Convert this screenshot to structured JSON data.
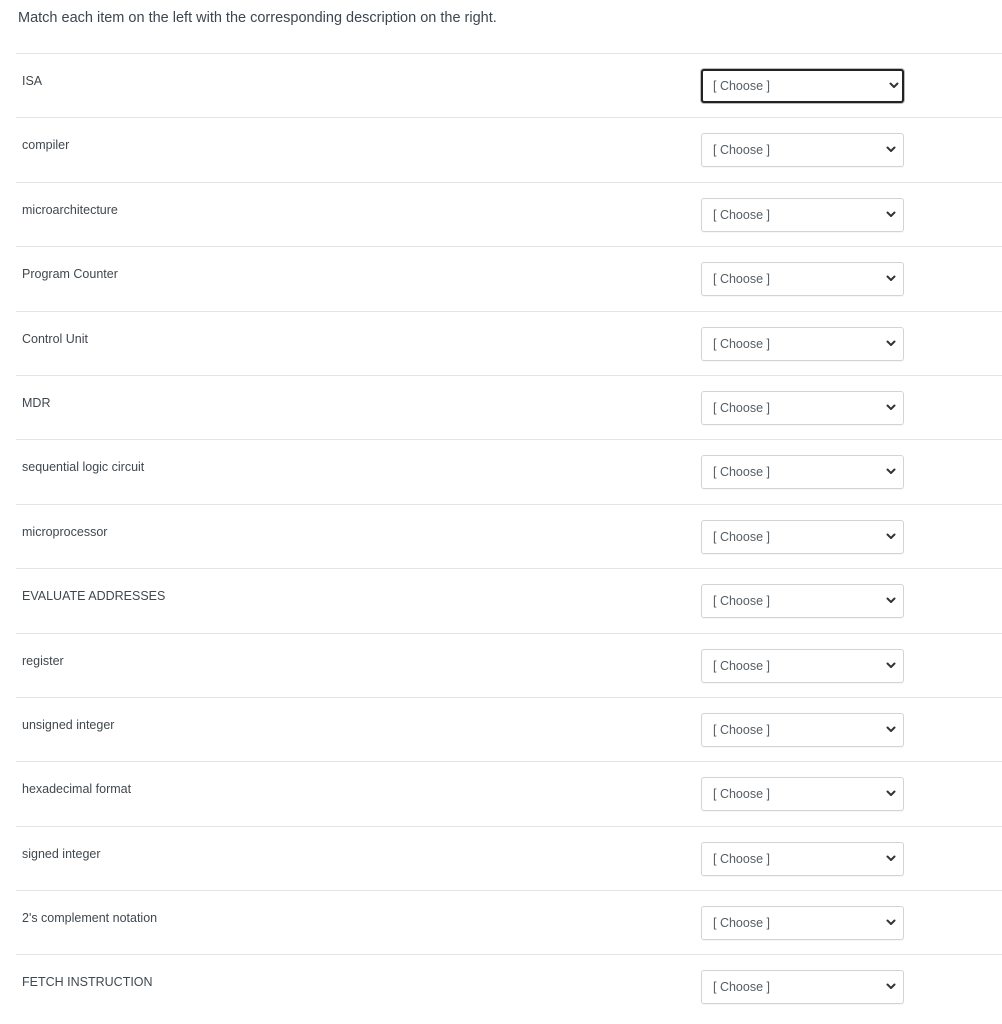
{
  "instructions": "Match each item on the left with the corresponding description on the right.",
  "placeholder": "[ Choose ]",
  "items": [
    {
      "label": "ISA",
      "selected": "[ Choose ]",
      "focused": true
    },
    {
      "label": "compiler",
      "selected": "[ Choose ]"
    },
    {
      "label": "microarchitecture",
      "selected": "[ Choose ]"
    },
    {
      "label": "Program Counter",
      "selected": "[ Choose ]"
    },
    {
      "label": "Control Unit",
      "selected": "[ Choose ]"
    },
    {
      "label": "MDR",
      "selected": "[ Choose ]"
    },
    {
      "label": "sequential logic circuit",
      "selected": "[ Choose ]"
    },
    {
      "label": "microprocessor",
      "selected": "[ Choose ]"
    },
    {
      "label": "EVALUATE ADDRESSES",
      "selected": "[ Choose ]"
    },
    {
      "label": "register",
      "selected": "[ Choose ]"
    },
    {
      "label": "unsigned integer",
      "selected": "[ Choose ]"
    },
    {
      "label": "hexadecimal format",
      "selected": "[ Choose ]"
    },
    {
      "label": "signed integer",
      "selected": "[ Choose ]"
    },
    {
      "label": "2's complement notation",
      "selected": "[ Choose ]"
    },
    {
      "label": "FETCH INSTRUCTION",
      "selected": "[ Choose ]"
    }
  ],
  "icons": {
    "dropdown": "chevron-down-icon"
  }
}
